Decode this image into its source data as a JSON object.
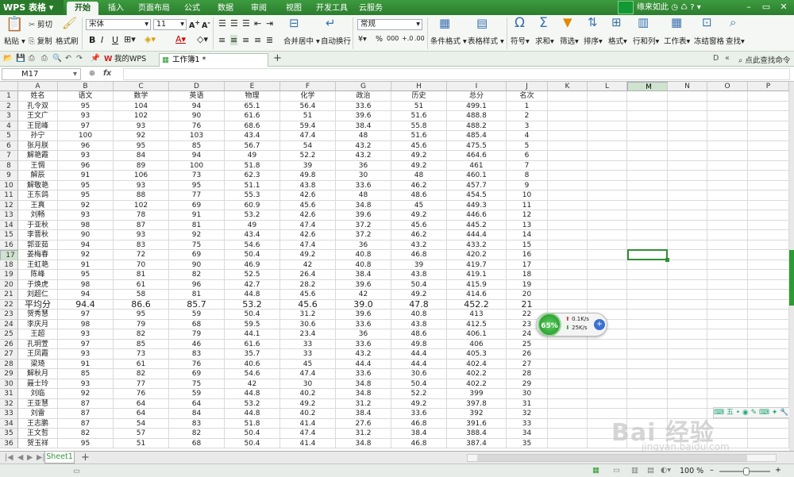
{
  "app": {
    "logo": "WPS 表格"
  },
  "menu": {
    "tabs": [
      "开始",
      "插入",
      "页面布局",
      "公式",
      "数据",
      "审阅",
      "视图",
      "开发工具",
      "云服务"
    ],
    "active": "开始"
  },
  "user": {
    "name": "缘来如此"
  },
  "ribbon": {
    "paste": "粘贴",
    "cut": "剪切",
    "copy": "复制",
    "format_painter": "格式刷",
    "font_name": "宋体",
    "font_size": "11",
    "bold": "B",
    "italic": "I",
    "underline": "U",
    "merge_center": "合并居中",
    "wrap_text": "自动换行",
    "number_format": "常规",
    "percent": "%",
    "thousands": "000",
    "conditional_format": "条件格式",
    "table_style": "表格样式",
    "symbol": "符号",
    "sum": "求和",
    "filter": "筛选",
    "sort": "排序",
    "format": "格式",
    "row_col": "行和列",
    "worksheet": "工作表",
    "freeze": "冻结窗格",
    "find": "查找"
  },
  "tabs": {
    "wps": "我的WPS",
    "doc": "工作簿1 *",
    "cmd": "点此查找命令"
  },
  "formula": {
    "cell_ref": "M17",
    "fx": "fx"
  },
  "columns": [
    "A",
    "B",
    "C",
    "D",
    "E",
    "F",
    "G",
    "H",
    "I",
    "J",
    "K",
    "L",
    "M",
    "N",
    "O",
    "P"
  ],
  "selected_column": "M",
  "selected_row": 17,
  "rows": [
    [
      "姓名",
      "语文",
      "数学",
      "英语",
      "物理",
      "化学",
      "政治",
      "历史",
      "总分",
      "名次"
    ],
    [
      "孔令双",
      "95",
      "104",
      "94",
      "65.1",
      "56.4",
      "33.6",
      "51",
      "499.1",
      "1"
    ],
    [
      "王文广",
      "93",
      "102",
      "90",
      "61.6",
      "51",
      "39.6",
      "51.6",
      "488.8",
      "2"
    ],
    [
      "王昆峰",
      "97",
      "93",
      "76",
      "68.6",
      "59.4",
      "38.4",
      "55.8",
      "488.2",
      "3"
    ],
    [
      "孙宁",
      "100",
      "92",
      "103",
      "43.4",
      "47.4",
      "48",
      "51.6",
      "485.4",
      "4"
    ],
    [
      "张月朕",
      "96",
      "95",
      "85",
      "56.7",
      "54",
      "43.2",
      "45.6",
      "475.5",
      "5"
    ],
    [
      "解艳霞",
      "93",
      "84",
      "94",
      "49",
      "52.2",
      "43.2",
      "49.2",
      "464.6",
      "6"
    ],
    [
      "王惆",
      "96",
      "89",
      "100",
      "51.8",
      "39",
      "36",
      "49.2",
      "461",
      "7"
    ],
    [
      "解辰",
      "91",
      "106",
      "73",
      "62.3",
      "49.8",
      "30",
      "48",
      "460.1",
      "8"
    ],
    [
      "解敬艳",
      "95",
      "93",
      "95",
      "51.1",
      "43.8",
      "33.6",
      "46.2",
      "457.7",
      "9"
    ],
    [
      "王东鸽",
      "95",
      "88",
      "77",
      "55.3",
      "42.6",
      "48",
      "48.6",
      "454.5",
      "10"
    ],
    [
      "王真",
      "92",
      "102",
      "69",
      "60.9",
      "45.6",
      "34.8",
      "45",
      "449.3",
      "11"
    ],
    [
      "刘畅",
      "93",
      "78",
      "91",
      "53.2",
      "42.6",
      "39.6",
      "49.2",
      "446.6",
      "12"
    ],
    [
      "于亚秋",
      "98",
      "87",
      "81",
      "49",
      "47.4",
      "37.2",
      "45.6",
      "445.2",
      "13"
    ],
    [
      "李晋秋",
      "90",
      "93",
      "92",
      "43.4",
      "42.6",
      "37.2",
      "46.2",
      "444.4",
      "14"
    ],
    [
      "郭亚茹",
      "94",
      "83",
      "75",
      "54.6",
      "47.4",
      "36",
      "43.2",
      "433.2",
      "15"
    ],
    [
      "姜梅春",
      "92",
      "72",
      "69",
      "50.4",
      "49.2",
      "40.8",
      "46.8",
      "420.2",
      "16"
    ],
    [
      "王虹艳",
      "91",
      "70",
      "90",
      "46.9",
      "42",
      "40.8",
      "39",
      "419.7",
      "17"
    ],
    [
      "陈峰",
      "95",
      "81",
      "82",
      "52.5",
      "26.4",
      "38.4",
      "43.8",
      "419.1",
      "18"
    ],
    [
      "于焕虎",
      "98",
      "61",
      "96",
      "42.7",
      "28.2",
      "39.6",
      "50.4",
      "415.9",
      "19"
    ],
    [
      "刘超仁",
      "94",
      "58",
      "81",
      "44.8",
      "45.6",
      "42",
      "49.2",
      "414.6",
      "20"
    ],
    [
      "平均分",
      "94.4",
      "86.6",
      "85.7",
      "53.2",
      "45.6",
      "39.0",
      "47.8",
      "452.2",
      "21"
    ],
    [
      "贺秀慧",
      "97",
      "95",
      "59",
      "50.4",
      "31.2",
      "39.6",
      "40.8",
      "413",
      "22"
    ],
    [
      "李庆月",
      "98",
      "79",
      "68",
      "59.5",
      "30.6",
      "33.6",
      "43.8",
      "412.5",
      "23"
    ],
    [
      "王超",
      "93",
      "82",
      "79",
      "44.1",
      "23.4",
      "36",
      "48.6",
      "406.1",
      "24"
    ],
    [
      "孔玥萱",
      "97",
      "85",
      "46",
      "61.6",
      "33",
      "33.6",
      "49.8",
      "406",
      "25"
    ],
    [
      "王凤霞",
      "93",
      "73",
      "83",
      "35.7",
      "33",
      "43.2",
      "44.4",
      "405.3",
      "26"
    ],
    [
      "梁琦",
      "91",
      "61",
      "76",
      "40.6",
      "45",
      "44.4",
      "44.4",
      "402.4",
      "27"
    ],
    [
      "解秋月",
      "85",
      "82",
      "69",
      "54.6",
      "47.4",
      "33.6",
      "30.6",
      "402.2",
      "28"
    ],
    [
      "聂士玲",
      "93",
      "77",
      "75",
      "42",
      "30",
      "34.8",
      "50.4",
      "402.2",
      "29"
    ],
    [
      "刘临",
      "92",
      "76",
      "59",
      "44.8",
      "40.2",
      "34.8",
      "52.2",
      "399",
      "30"
    ],
    [
      "王亚慧",
      "87",
      "64",
      "64",
      "53.2",
      "49.2",
      "31.2",
      "49.2",
      "397.8",
      "31"
    ],
    [
      "刘雷",
      "87",
      "64",
      "84",
      "44.8",
      "40.2",
      "38.4",
      "33.6",
      "392",
      "32"
    ],
    [
      "王志鹏",
      "87",
      "54",
      "83",
      "51.8",
      "41.4",
      "27.6",
      "46.8",
      "391.6",
      "33"
    ],
    [
      "王文哲",
      "82",
      "57",
      "82",
      "50.4",
      "47.4",
      "31.2",
      "38.4",
      "388.4",
      "34"
    ],
    [
      "贺玉祥",
      "95",
      "51",
      "68",
      "50.4",
      "41.4",
      "34.8",
      "46.8",
      "387.4",
      "35"
    ]
  ],
  "speed_widget": {
    "percent": "65%",
    "up": "0.1K/s",
    "down": "25K/s"
  },
  "sheet_tab": "Sheet1",
  "zoom": "100 %",
  "watermark": {
    "main": "Bai 经验",
    "url": "jingyan.baidu.com"
  },
  "colors": {
    "accent": "#2e9a34",
    "title_bar": "#3c9b3e"
  }
}
